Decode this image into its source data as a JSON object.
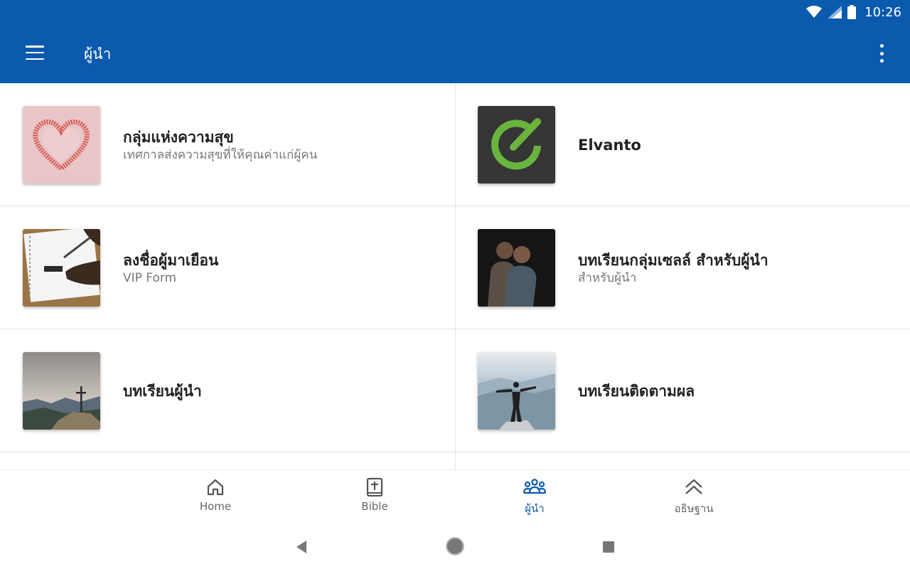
{
  "status": {
    "time": "10:26"
  },
  "appbar": {
    "title": "ผู้นำ"
  },
  "items": [
    {
      "title": "กลุ่มแห่งความสุข",
      "subtitle": "เทศกาลส่งความสุขที่ให้คุณค่าแก่ผู้คน"
    },
    {
      "title": "Elvanto",
      "subtitle": ""
    },
    {
      "title": "ลงชื่อผู้มาเยือน",
      "subtitle": "VIP Form"
    },
    {
      "title": "บทเรียนกลุ่มเซลล์ สำหรับผู้นำ",
      "subtitle": "สำหรับผู้นำ"
    },
    {
      "title": "บทเรียนผู้นำ",
      "subtitle": ""
    },
    {
      "title": "บทเรียนติดตามผล",
      "subtitle": ""
    }
  ],
  "nav": [
    {
      "label": "Home",
      "icon": "home-icon"
    },
    {
      "label": "Bible",
      "icon": "bible-icon"
    },
    {
      "label": "ผู้นำ",
      "icon": "group-icon"
    },
    {
      "label": "อธิษฐาน",
      "icon": "double-chevron-up-icon"
    }
  ],
  "colors": {
    "primary": "#0a5aae",
    "elvanto_green": "#6ab43e"
  }
}
